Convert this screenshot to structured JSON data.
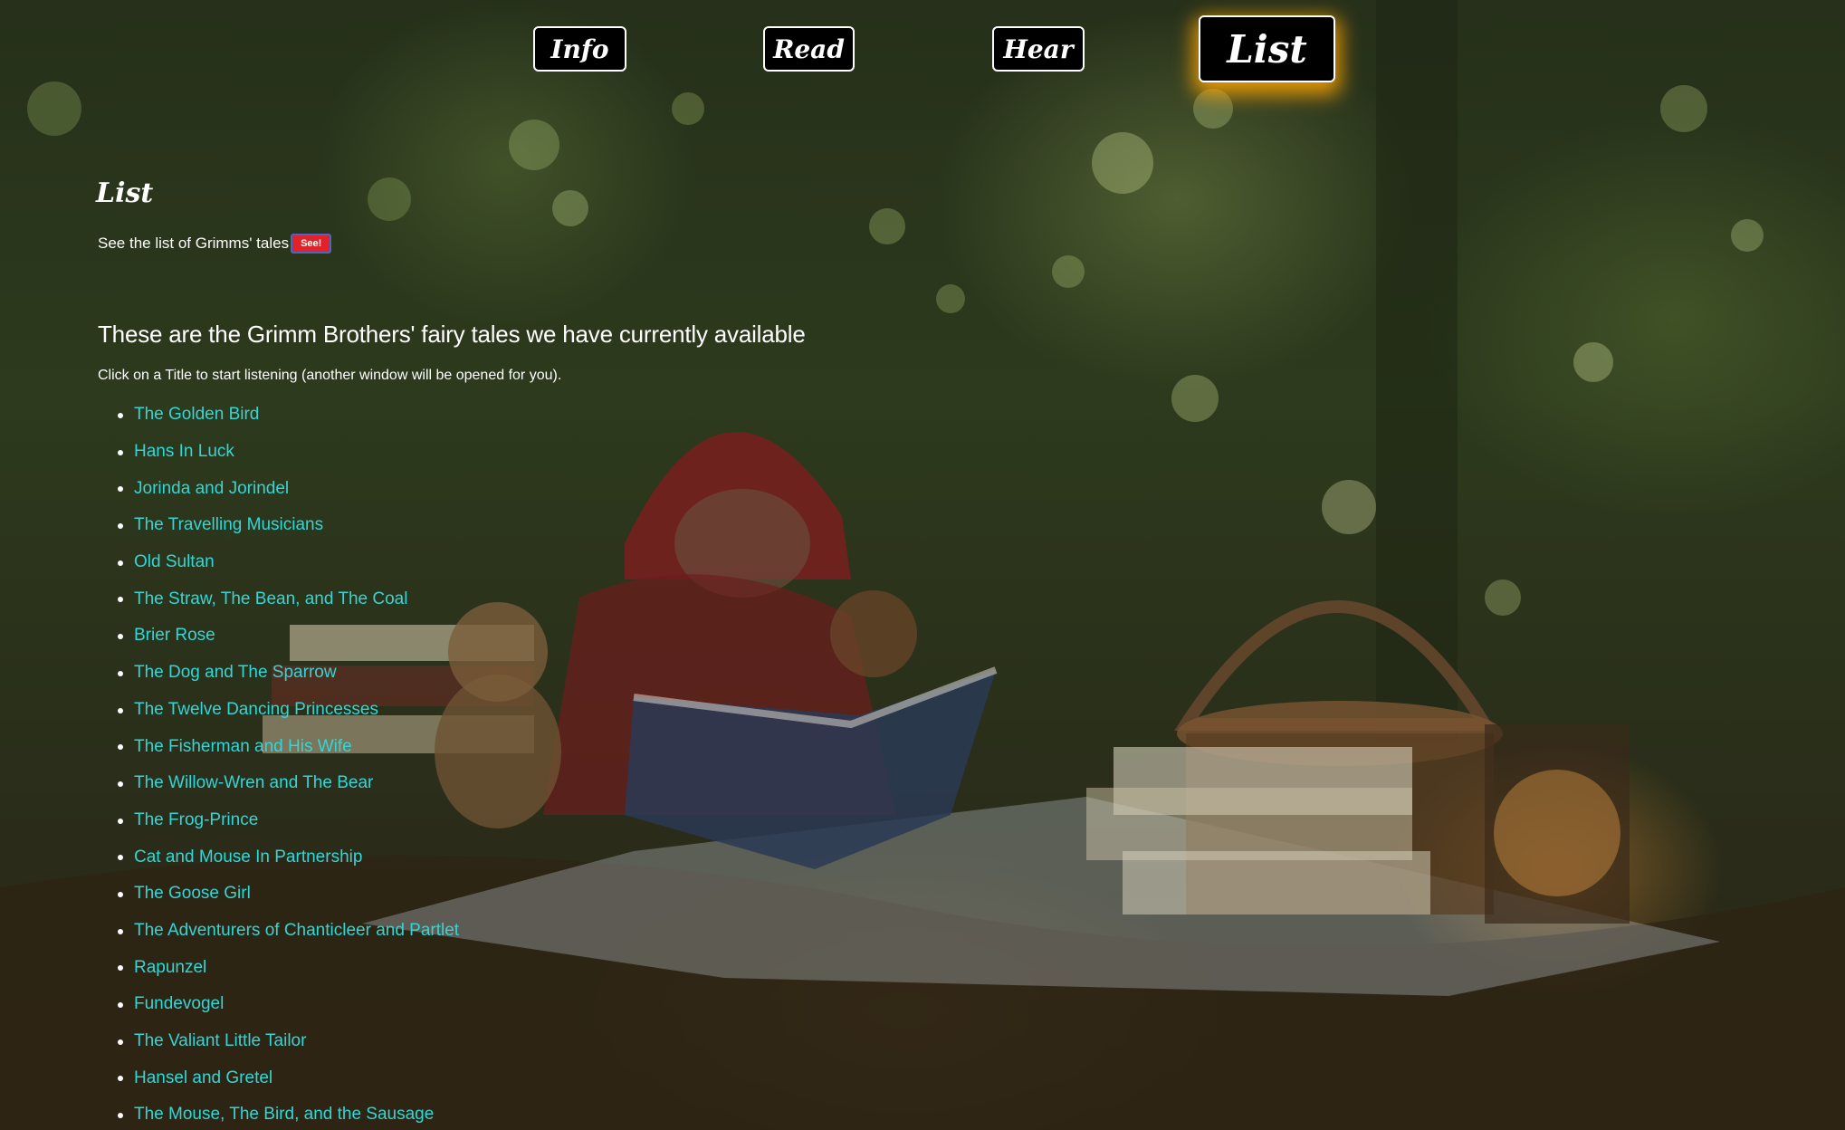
{
  "nav": {
    "info_label": "Info",
    "read_label": "Read",
    "hear_label": "Hear",
    "list_label": "List",
    "active": "List"
  },
  "section": {
    "title": "List",
    "see_text": "See the list of Grimms' tales",
    "see_button": "See!"
  },
  "content": {
    "headline": "These are the Grimm Brothers' fairy tales we have currently available",
    "instruction": "Click on a Title to start listening (another window will be opened for you).",
    "tales": [
      "The Golden Bird",
      "Hans In Luck",
      "Jorinda and Jorindel",
      "The Travelling Musicians",
      "Old Sultan",
      "The Straw, The Bean, and The Coal",
      "Brier Rose",
      "The Dog and The Sparrow",
      "The Twelve Dancing Princesses",
      "The Fisherman and His Wife",
      "The Willow-Wren and The Bear",
      "The Frog-Prince",
      "Cat and Mouse In Partnership",
      "The Goose Girl",
      "The Adventurers of Chanticleer and Partlet",
      "Rapunzel",
      "Fundevogel",
      "The Valiant Little Tailor",
      "Hansel and Gretel",
      "The Mouse, The Bird, and the Sausage"
    ]
  },
  "colors": {
    "link": "#33d6d6",
    "see_button": "#e0222a",
    "nav_glow": "#ffa500",
    "text": "#ffffff"
  }
}
